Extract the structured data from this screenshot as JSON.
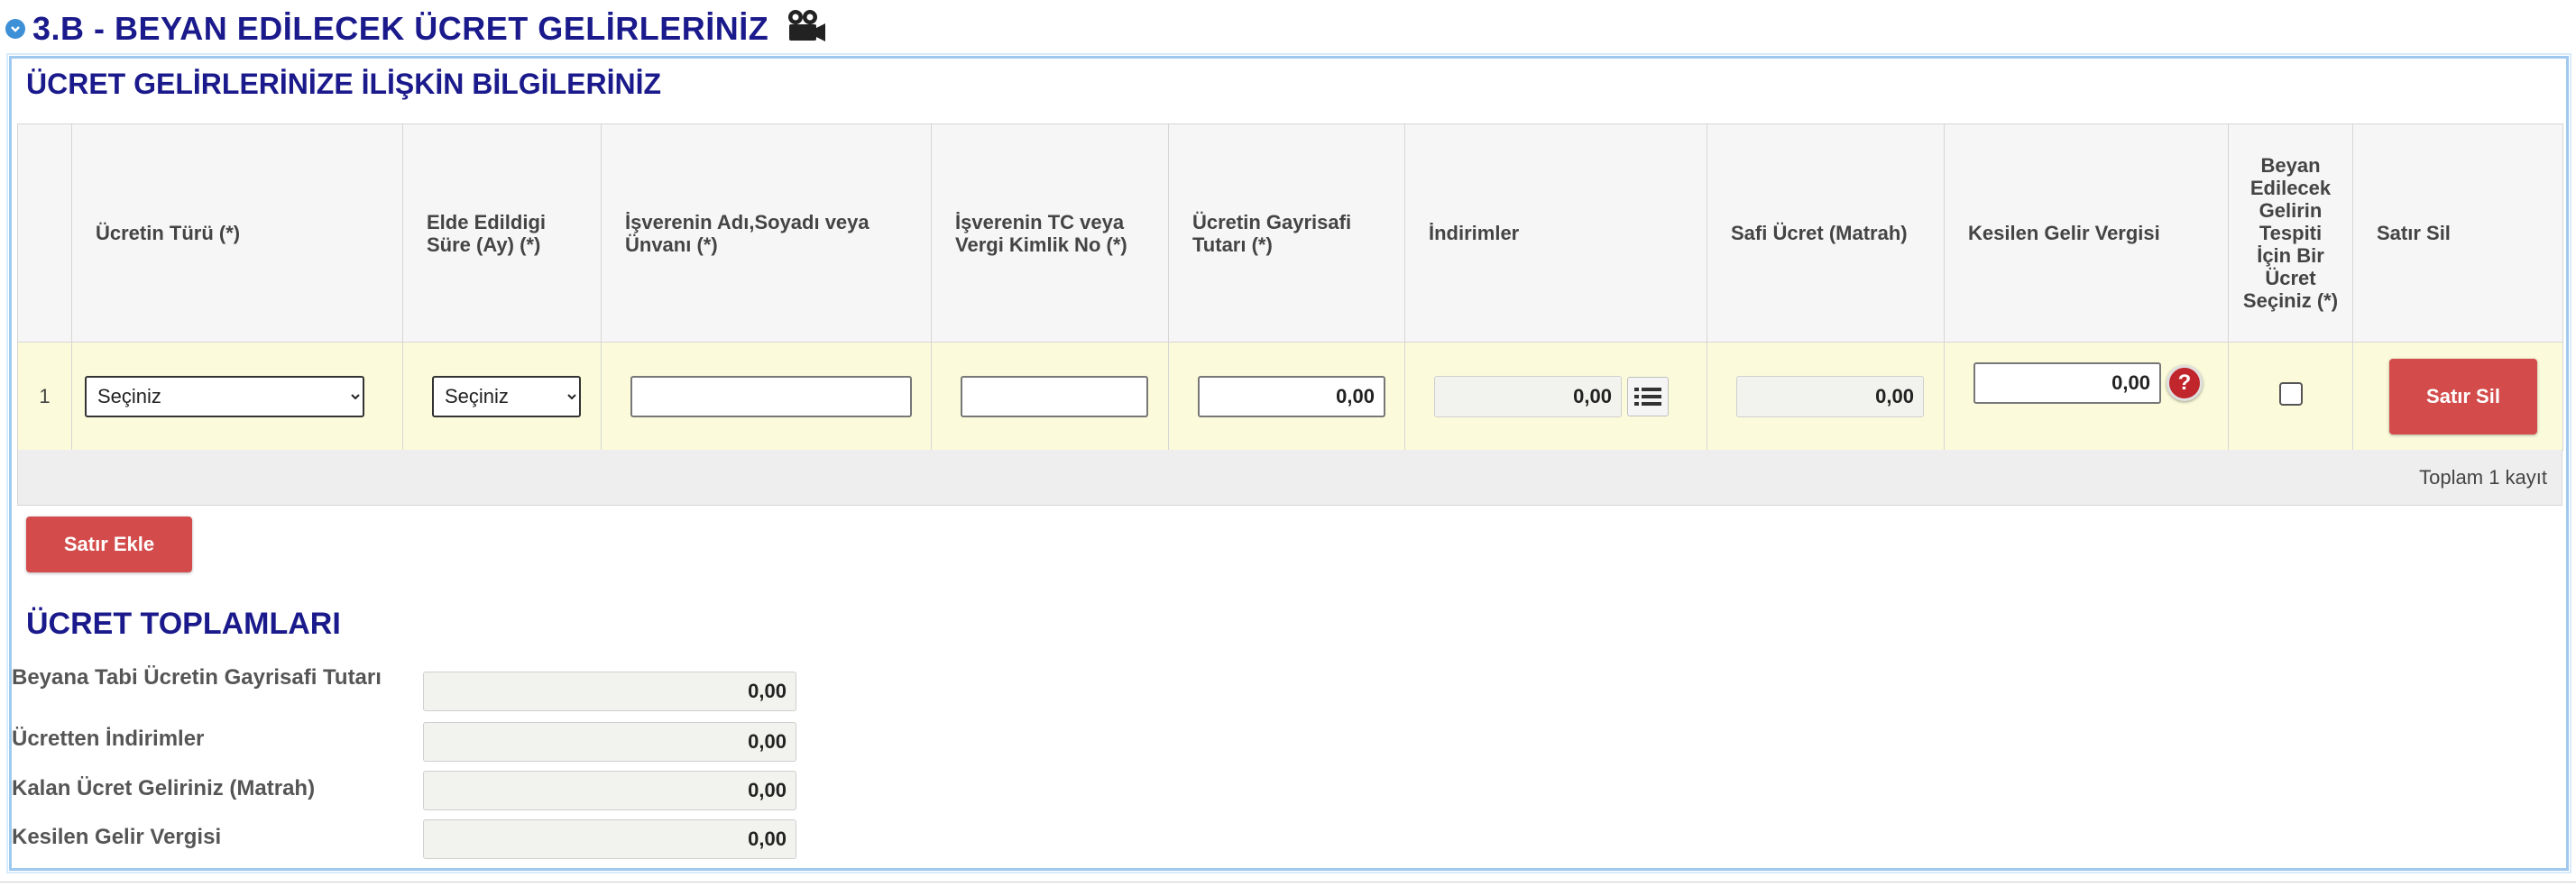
{
  "section": {
    "title": "3.B - BEYAN EDİLECEK ÜCRET GELİRLERİNİZ",
    "icons": [
      "collapse-chevron-icon",
      "video-camera-icon"
    ]
  },
  "panel": {
    "title": "ÜCRET GELİRLERİNİZE İLİŞKİN BİLGİLERİNİZ"
  },
  "table": {
    "headers": {
      "ucret_turu": "Ücretin Türü (*)",
      "sure": "Elde Edildigi Süre (Ay) (*)",
      "isveren_adi": "İşverenin Adı,Soyadı veya Ünvanı (*)",
      "isveren_tc": "İşverenin TC veya Vergi Kimlik No (*)",
      "gayrisafi": "Ücretin Gayrisafi Tutarı (*)",
      "indirimler": "İndirimler",
      "safi": "Safi Ücret (Matrah)",
      "kesilen": "Kesilen Gelir Vergisi",
      "tespit": "Beyan Edilecek Gelirin Tespiti İçin Bir Ücret Seçiniz (*)",
      "sil": "Satır Sil"
    },
    "rows": [
      {
        "no": "1",
        "ucret_turu": "Seçiniz",
        "sure": "Seçiniz",
        "isveren_adi": "",
        "isveren_tc": "",
        "gayrisafi": "0,00",
        "indirimler": "0,00",
        "safi": "0,00",
        "kesilen": "0,00",
        "tespit_checked": false,
        "delete_label": "Satır Sil"
      }
    ],
    "footer": "Toplam 1 kayıt"
  },
  "add_button": "Satır Ekle",
  "totals": {
    "title": "ÜCRET TOPLAMLARI",
    "items": [
      {
        "label": "Beyana Tabi Ücretin Gayrisafi Tutarı",
        "value": "0,00"
      },
      {
        "label": "Ücretten İndirimler",
        "value": "0,00"
      },
      {
        "label": "Kalan Ücret Geliriniz (Matrah)",
        "value": "0,00"
      },
      {
        "label": "Kesilen Gelir Vergisi",
        "value": "0,00"
      }
    ]
  },
  "colors": {
    "heading": "#1a1a8c",
    "accent_blue": "#3d8fd6",
    "button_red": "#d34b4b",
    "row_bg": "#fbfbdb",
    "panel_border": "#9fc9ee"
  }
}
